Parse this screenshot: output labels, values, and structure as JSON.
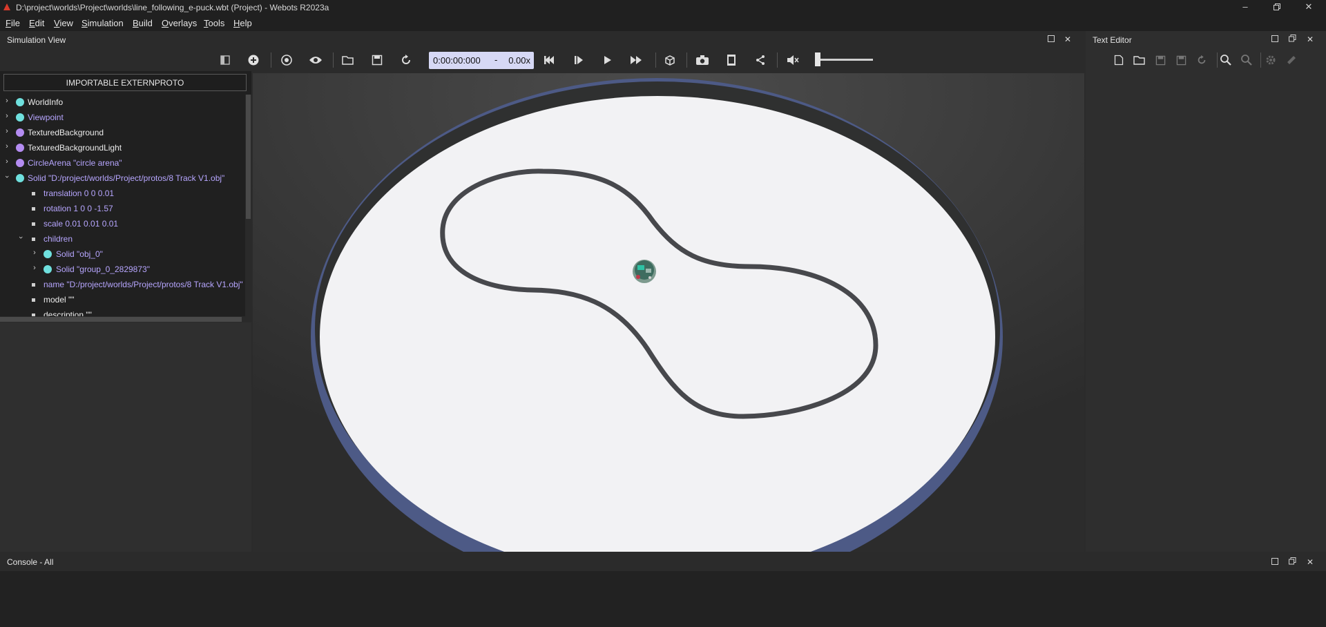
{
  "window": {
    "title": "D:\\project\\worlds\\Project\\worlds\\line_following_e-puck.wbt (Project) - Webots R2023a",
    "controls": [
      "minimize-icon",
      "restore-icon",
      "close-icon"
    ]
  },
  "menu": {
    "items": [
      {
        "first": "F",
        "rest": "ile"
      },
      {
        "first": "E",
        "rest": "dit"
      },
      {
        "first": "V",
        "rest": "iew"
      },
      {
        "first": "S",
        "rest": "imulation"
      },
      {
        "first": "B",
        "rest": "uild"
      },
      {
        "first": "O",
        "rest": "verlays"
      },
      {
        "first": "T",
        "rest": "ools"
      },
      {
        "first": "H",
        "rest": "elp"
      }
    ]
  },
  "simulation_view": {
    "title": "Simulation View",
    "time": "0:00:00:000",
    "time_separator": "-",
    "speed": "0.00x"
  },
  "scene_tree": {
    "import_button": "IMPORTABLE EXTERNPROTO",
    "nodes": [
      {
        "label": "WorldInfo",
        "color": "#6fe0de"
      },
      {
        "label": "Viewpoint",
        "color": "#6fe0de"
      },
      {
        "label": "TexturedBackground",
        "color": "#b48cf2"
      },
      {
        "label": "TexturedBackgroundLight",
        "color": "#b48cf2"
      },
      {
        "label": "CircleArena \"circle arena\"",
        "color": "#b48cf2"
      },
      {
        "label": "Solid \"D:/project/worlds/Project/protos/8 Track V1.obj\"",
        "color": "#6fe0de"
      },
      {
        "label": "translation 0 0 0.01"
      },
      {
        "label": "rotation 1 0 0 -1.57"
      },
      {
        "label": "scale 0.01 0.01 0.01"
      },
      {
        "label": "children"
      },
      {
        "label": "Solid \"obj_0\"",
        "color": "#6fe0de"
      },
      {
        "label": "Solid \"group_0_2829873\"",
        "color": "#6fe0de"
      },
      {
        "label": "name \"D:/project/worlds/Project/protos/8 Track V1.obj\""
      },
      {
        "label": "model \"\""
      },
      {
        "label": "description \"\""
      }
    ]
  },
  "text_editor": {
    "title": "Text Editor"
  },
  "console": {
    "title": "Console - All"
  },
  "colors": {
    "accent_purple": "#b7a6ff",
    "arena_floor": "#f2f2f4",
    "arena_wall": "#4d5a86",
    "track_line": "#47484c"
  }
}
